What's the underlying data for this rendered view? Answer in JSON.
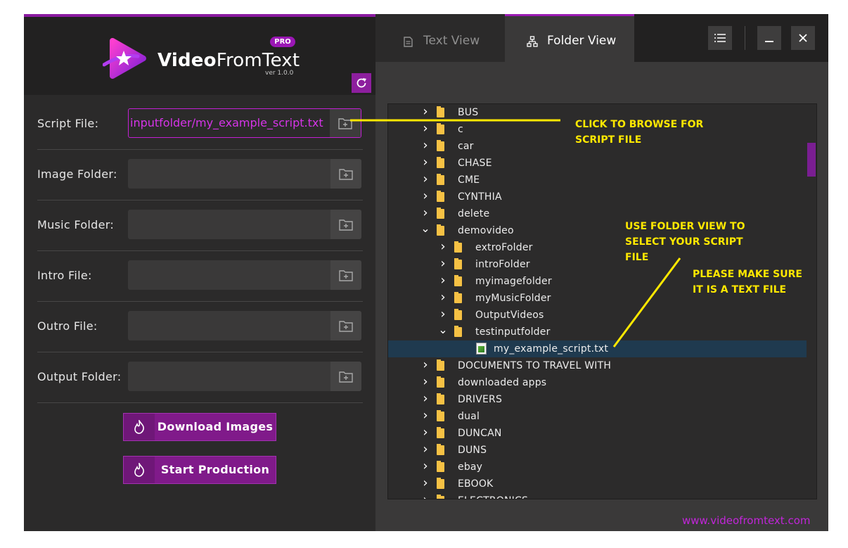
{
  "app": {
    "brand_bold": "Video",
    "brand_rest": "FromText",
    "pro_badge": "PRO",
    "version": "ver 1.0.0",
    "accent_color": "#9b17b5"
  },
  "form": {
    "rows": [
      {
        "label": "Script File:",
        "value": "inputfolder/my_example_script.txt"
      },
      {
        "label": "Image Folder:",
        "value": ""
      },
      {
        "label": "Music Folder:",
        "value": ""
      },
      {
        "label": "Intro File:",
        "value": ""
      },
      {
        "label": "Outro File:",
        "value": ""
      },
      {
        "label": "Output Folder:",
        "value": ""
      }
    ],
    "download_label": "Download Images",
    "start_label": "Start Production"
  },
  "tabs": {
    "text_view": "Text View",
    "folder_view": "Folder View",
    "active": "Folder View"
  },
  "tree": {
    "items": [
      {
        "label": "BUS",
        "level": 0,
        "type": "folder",
        "state": "collapsed"
      },
      {
        "label": "c",
        "level": 0,
        "type": "folder",
        "state": "collapsed"
      },
      {
        "label": "car",
        "level": 0,
        "type": "folder",
        "state": "collapsed"
      },
      {
        "label": "CHASE",
        "level": 0,
        "type": "folder",
        "state": "collapsed"
      },
      {
        "label": "CME",
        "level": 0,
        "type": "folder",
        "state": "collapsed"
      },
      {
        "label": "CYNTHIA",
        "level": 0,
        "type": "folder",
        "state": "collapsed"
      },
      {
        "label": "delete",
        "level": 0,
        "type": "folder",
        "state": "collapsed"
      },
      {
        "label": "demovideo",
        "level": 0,
        "type": "folder",
        "state": "expanded"
      },
      {
        "label": "extroFolder",
        "level": 1,
        "type": "folder",
        "state": "collapsed"
      },
      {
        "label": "introFolder",
        "level": 1,
        "type": "folder",
        "state": "collapsed"
      },
      {
        "label": "myimagefolder",
        "level": 1,
        "type": "folder",
        "state": "collapsed"
      },
      {
        "label": "myMusicFolder",
        "level": 1,
        "type": "folder",
        "state": "collapsed"
      },
      {
        "label": "OutputVideos",
        "level": 1,
        "type": "folder",
        "state": "collapsed"
      },
      {
        "label": "testinputfolder",
        "level": 1,
        "type": "folder",
        "state": "expanded"
      },
      {
        "label": "my_example_script.txt",
        "level": 2,
        "type": "file",
        "state": "selected"
      },
      {
        "label": "DOCUMENTS TO TRAVEL WITH",
        "level": 0,
        "type": "folder",
        "state": "collapsed"
      },
      {
        "label": "downloaded apps",
        "level": 0,
        "type": "folder",
        "state": "collapsed"
      },
      {
        "label": "DRIVERS",
        "level": 0,
        "type": "folder",
        "state": "collapsed"
      },
      {
        "label": "dual",
        "level": 0,
        "type": "folder",
        "state": "collapsed"
      },
      {
        "label": "DUNCAN",
        "level": 0,
        "type": "folder",
        "state": "collapsed"
      },
      {
        "label": "DUNS",
        "level": 0,
        "type": "folder",
        "state": "collapsed"
      },
      {
        "label": "ebay",
        "level": 0,
        "type": "folder",
        "state": "collapsed"
      },
      {
        "label": "EBOOK",
        "level": 0,
        "type": "folder",
        "state": "collapsed"
      },
      {
        "label": "ELECTRONICS",
        "level": 0,
        "type": "folder",
        "state": "collapsed"
      }
    ]
  },
  "footer": {
    "website": "www.videofromtext.com"
  },
  "annotations": {
    "browse": "CLICK TO BROWSE FOR\nSCRIPT FILE",
    "folder_view": "USE FOLDER VIEW TO\nSELECT YOUR SCRIPT\nFILE",
    "text_file": "PLEASE MAKE SURE\nIT IS A TEXT FILE",
    "color": "#ffe800"
  }
}
